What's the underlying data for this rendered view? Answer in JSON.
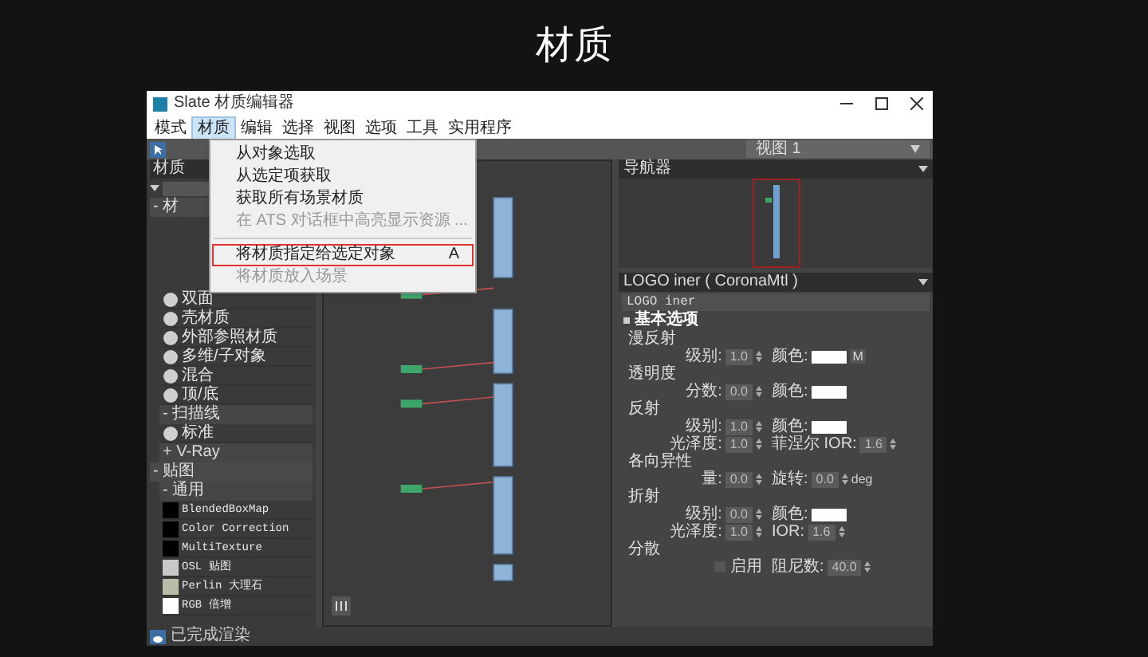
{
  "slide_title": "材质",
  "window": {
    "title": "Slate 材质编辑器"
  },
  "menu_bar": [
    {
      "label": "模式",
      "selected": false
    },
    {
      "label": "材质",
      "selected": true
    },
    {
      "label": "编辑",
      "selected": false
    },
    {
      "label": "选择",
      "selected": false
    },
    {
      "label": "视图",
      "selected": false
    },
    {
      "label": "选项",
      "selected": false
    },
    {
      "label": "工具",
      "selected": false
    },
    {
      "label": "实用程序",
      "selected": false
    }
  ],
  "dropdown_menu": [
    {
      "kind": "item",
      "label": "从对象选取",
      "disabled": false,
      "highlighted": false
    },
    {
      "kind": "item",
      "label": "从选定项获取",
      "disabled": false,
      "highlighted": false
    },
    {
      "kind": "item",
      "label": "获取所有场景材质",
      "disabled": false,
      "highlighted": false
    },
    {
      "kind": "item",
      "label": "在 ATS 对话框中高亮显示资源 ...",
      "disabled": true,
      "highlighted": false
    },
    {
      "kind": "separator"
    },
    {
      "kind": "item",
      "label": "将材质指定给选定对象",
      "shortcut": "A",
      "disabled": false,
      "highlighted": true
    },
    {
      "kind": "item",
      "label": "将材质放入场景",
      "disabled": true,
      "highlighted": false
    }
  ],
  "view_dropdown": "视图 1",
  "browser": {
    "title": "材质",
    "top_group": "- 材",
    "rows": [
      {
        "kind": "material",
        "label": "双面"
      },
      {
        "kind": "material",
        "label": "壳材质"
      },
      {
        "kind": "material",
        "label": "外部参照材质"
      },
      {
        "kind": "material",
        "label": "多维/子对象"
      },
      {
        "kind": "material",
        "label": "混合"
      },
      {
        "kind": "material",
        "label": "顶/底"
      },
      {
        "kind": "subgroup",
        "label": "- 扫描线"
      },
      {
        "kind": "material",
        "label": "标准"
      },
      {
        "kind": "subgroup",
        "label": "+ V-Ray"
      },
      {
        "kind": "group",
        "label": "- 贴图"
      },
      {
        "kind": "subgroup",
        "label": "- 通用"
      },
      {
        "kind": "map",
        "label": "BlendedBoxMap",
        "color": "#000000"
      },
      {
        "kind": "map",
        "label": "Color Correction",
        "color": "#000000"
      },
      {
        "kind": "map",
        "label": "MultiTexture",
        "color": "#000000"
      },
      {
        "kind": "map",
        "label": "OSL 贴图",
        "color": "#c8c8c8"
      },
      {
        "kind": "map",
        "label": "Perlin 大理石",
        "color": "#b8bca8"
      },
      {
        "kind": "map",
        "label": "RGB 倍增",
        "color": "#ffffff"
      }
    ]
  },
  "navigator": {
    "title": "导航器"
  },
  "material_panel": {
    "title": "LOGO iner ( CoronaMtl )",
    "name": "LOGO iner",
    "rollout": "基本选项",
    "rows": [
      {
        "kind": "title",
        "label": "漫反射"
      },
      {
        "kind": "params",
        "items": [
          {
            "kind": "spinner",
            "label": "级别:",
            "value": "1.0"
          },
          {
            "kind": "color",
            "label": "颜色:",
            "map": "M"
          }
        ]
      },
      {
        "kind": "title",
        "label": "透明度"
      },
      {
        "kind": "params",
        "items": [
          {
            "kind": "spinner",
            "label": "分数:",
            "value": "0.0"
          },
          {
            "kind": "color",
            "label": "颜色:"
          }
        ]
      },
      {
        "kind": "title",
        "label": "反射"
      },
      {
        "kind": "params",
        "items": [
          {
            "kind": "spinner",
            "label": "级别:",
            "value": "1.0"
          },
          {
            "kind": "color",
            "label": "颜色:"
          }
        ]
      },
      {
        "kind": "params",
        "items": [
          {
            "kind": "spinner",
            "label": "光泽度:",
            "value": "1.0"
          },
          {
            "kind": "spinner",
            "label": "菲涅尔 IOR:",
            "value": "1.6"
          }
        ]
      },
      {
        "kind": "title",
        "label": "各向异性"
      },
      {
        "kind": "params",
        "items": [
          {
            "kind": "spinner",
            "label": "量:",
            "value": "0.0"
          },
          {
            "kind": "spinner",
            "label": "旋转:",
            "value": "0.0",
            "unit": "deg"
          }
        ]
      },
      {
        "kind": "title",
        "label": "折射"
      },
      {
        "kind": "params",
        "items": [
          {
            "kind": "spinner",
            "label": "级别:",
            "value": "0.0"
          },
          {
            "kind": "color",
            "label": "颜色:"
          }
        ]
      },
      {
        "kind": "params",
        "items": [
          {
            "kind": "spinner",
            "label": "光泽度:",
            "value": "1.0"
          },
          {
            "kind": "spinner",
            "label": "IOR:",
            "value": "1.6"
          }
        ]
      },
      {
        "kind": "title",
        "label": "分散"
      },
      {
        "kind": "params",
        "items": [
          {
            "kind": "checkbox",
            "label": "启用",
            "checked": false
          },
          {
            "kind": "spinner",
            "label": "阻尼数:",
            "value": "40.0"
          }
        ]
      }
    ]
  },
  "status_bar": "已完成渲染"
}
